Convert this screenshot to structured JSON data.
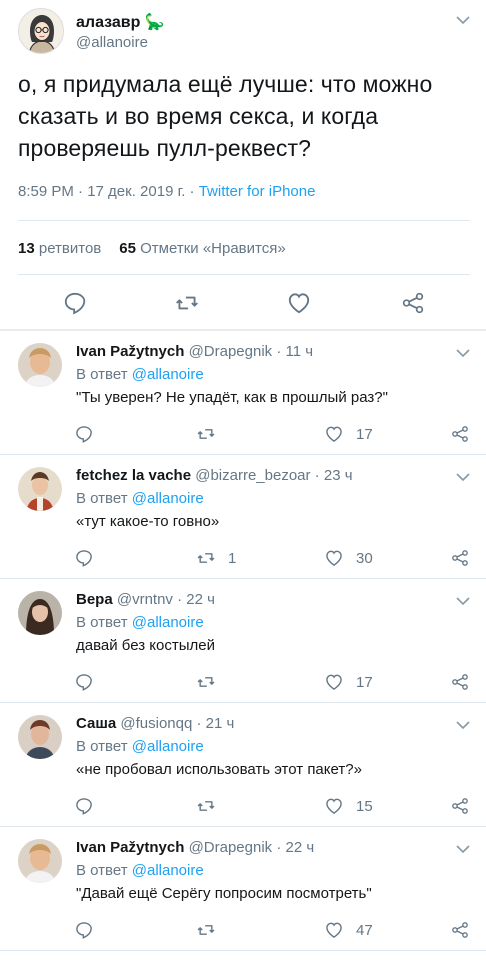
{
  "main_tweet": {
    "author_name": "алазавр",
    "author_emoji": "🦕",
    "handle": "@allanoire",
    "text": "о, я придумала ещё лучше: что можно сказать и во время секса, и когда проверяешь пулл-реквест?",
    "time": "8:59 PM · 17 дек. 2019 г. · ",
    "source": "Twitter for iPhone",
    "retweets_count": "13",
    "retweets_label": "ретвитов",
    "likes_count": "65",
    "likes_label": "Отметки «Нравится»"
  },
  "reply_prefix": "В ответ",
  "replies": [
    {
      "name": "Ivan Pažytnych",
      "meta": "@Drapegnik · 11 ч",
      "mention": "@allanoire",
      "text": "\"Ты уверен? Не упадёт, как в прошлый раз?\"",
      "retweets": "",
      "likes": "17"
    },
    {
      "name": "fetchez la vache",
      "meta": "@bizarre_bezoar · 23 ч",
      "mention": "@allanoire",
      "text": "«тут какое-то говно»",
      "retweets": "1",
      "likes": "30"
    },
    {
      "name": "Вера",
      "meta": "@vrntnv · 22 ч",
      "mention": "@allanoire",
      "text": "давай без костылей",
      "retweets": "",
      "likes": "17"
    },
    {
      "name": "Саша",
      "meta": "@fusionqq · 21 ч",
      "mention": "@allanoire",
      "text": "«не пробовал использовать этот пакет?»",
      "retweets": "",
      "likes": "15"
    },
    {
      "name": "Ivan Pažytnych",
      "meta": "@Drapegnik · 22 ч",
      "mention": "@allanoire",
      "text": "\"Давай ещё Серёгу попросим посмотреть\"",
      "retweets": "",
      "likes": "47"
    }
  ],
  "colors": {
    "accent": "#1da1f2",
    "secondary_text": "#657786",
    "primary_text": "#14171a",
    "divider": "#e1e8ed"
  }
}
